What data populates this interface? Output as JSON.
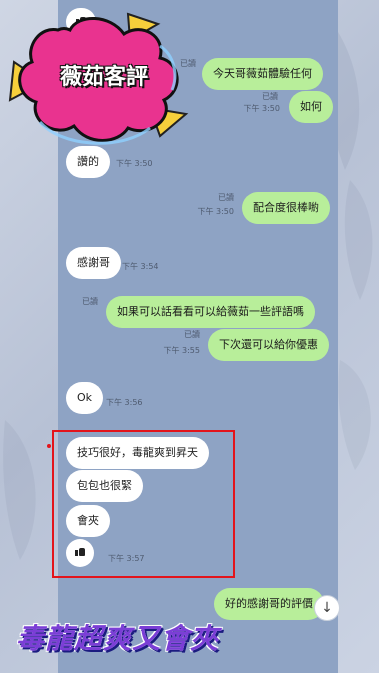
{
  "badge": {
    "title": "薇茹客評"
  },
  "caption": {
    "text": "毒龍超爽又會夾"
  },
  "messages": [
    {
      "id": "m1",
      "dir": "incoming",
      "icon": "thumbs-up-icon",
      "text": ""
    },
    {
      "id": "m2",
      "dir": "outgoing",
      "text": "今天哥薇茹體驗任何",
      "read": "已讀",
      "time": ""
    },
    {
      "id": "m3",
      "dir": "outgoing",
      "text": "如何",
      "read": "已讀",
      "time": "下午 3:50"
    },
    {
      "id": "m4",
      "dir": "incoming",
      "text": "讚的",
      "time": "下午 3:50"
    },
    {
      "id": "m5",
      "dir": "outgoing",
      "text": "配合度很棒喲",
      "read": "已讀",
      "time": "下午 3:50"
    },
    {
      "id": "m6",
      "dir": "incoming",
      "text": "感謝哥",
      "time": "下午 3:54"
    },
    {
      "id": "m7",
      "dir": "outgoing",
      "text": "如果可以話看看可以給薇茹一些評語嗎",
      "read": "已讀",
      "time": ""
    },
    {
      "id": "m8",
      "dir": "outgoing",
      "text": "下次還可以給你優惠",
      "read": "已讀",
      "time": "下午 3:55"
    },
    {
      "id": "m9",
      "dir": "incoming",
      "text": "Ok",
      "time": "下午 3:56"
    },
    {
      "id": "m10",
      "dir": "incoming",
      "text": "技巧很好，毒龍爽到昇天",
      "time": ""
    },
    {
      "id": "m11",
      "dir": "incoming",
      "text": "包包也很緊",
      "time": ""
    },
    {
      "id": "m12",
      "dir": "incoming",
      "text": "會夾",
      "time": ""
    },
    {
      "id": "m13",
      "dir": "incoming",
      "icon": "thumbs-up-icon",
      "text": "",
      "time": "下午 3:57"
    },
    {
      "id": "m14",
      "dir": "outgoing",
      "text": "好的感謝哥的評價",
      "read": "",
      "time": ""
    }
  ],
  "scroll_button": {
    "icon": "arrow-down-icon",
    "glyph": "↓"
  },
  "colors": {
    "chat_background": "#8ea3c4",
    "outgoing_bubble": "#b8ee9a",
    "incoming_bubble": "#ffffff",
    "highlight_border": "#e3141b",
    "badge_pink": "#e9338f",
    "badge_yellow": "#f6cf3b"
  }
}
